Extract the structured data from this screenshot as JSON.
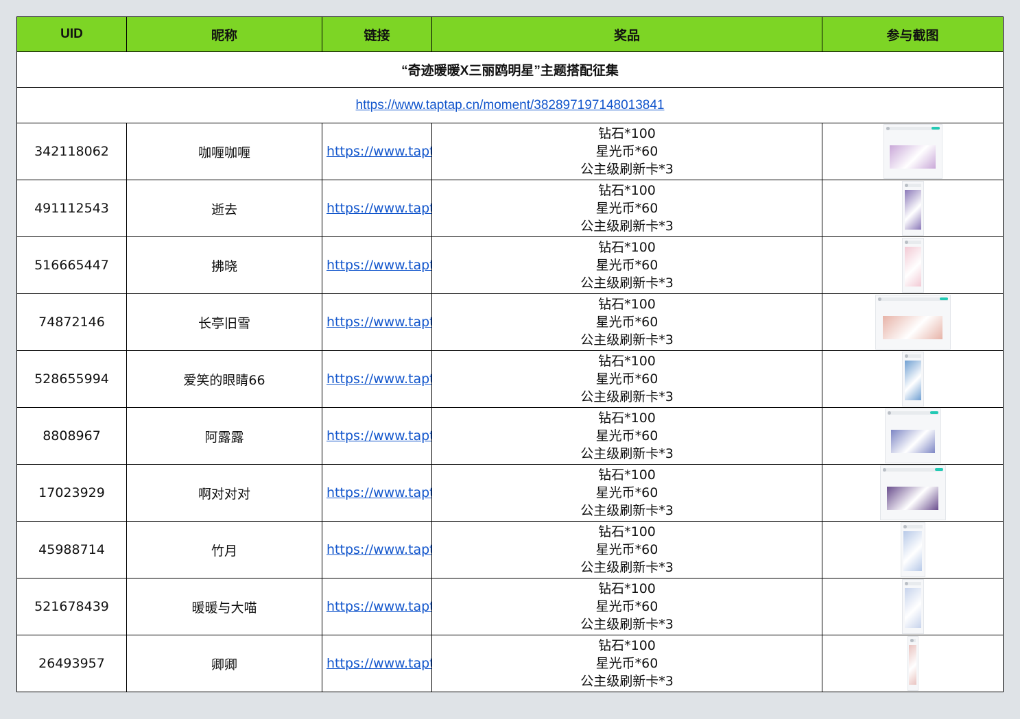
{
  "headers": {
    "uid": "UID",
    "nickname": "昵称",
    "link": "链接",
    "prize": "奖品",
    "screenshot": "参与截图"
  },
  "event_title": "“奇迹暖暖X三丽鸥明星”主题搭配征集",
  "event_url": "https://www.taptap.cn/moment/382897197148013841",
  "rows": [
    {
      "uid": "342118062",
      "nickname": "咖喱咖喱",
      "link": "https://www.taptap",
      "prize": [
        "钻石*100",
        "星光币*60",
        "公主级刷新卡*3"
      ]
    },
    {
      "uid": "491112543",
      "nickname": "逝去",
      "link": "https://www.taptap",
      "prize": [
        "钻石*100",
        "星光币*60",
        "公主级刷新卡*3"
      ]
    },
    {
      "uid": "516665447",
      "nickname": "拂晓",
      "link": "https://www.taptap",
      "prize": [
        "钻石*100",
        "星光币*60",
        "公主级刷新卡*3"
      ]
    },
    {
      "uid": "74872146",
      "nickname": "长亭旧雪",
      "link": "https://www.taptap",
      "prize": [
        "钻石*100",
        "星光币*60",
        "公主级刷新卡*3"
      ]
    },
    {
      "uid": "528655994",
      "nickname": "爱笑的眼睛66",
      "link": "https://www.taptap",
      "prize": [
        "钻石*100",
        "星光币*60",
        "公主级刷新卡*3"
      ]
    },
    {
      "uid": "8808967",
      "nickname": "阿露露",
      "link": "https://www.taptap",
      "prize": [
        "钻石*100",
        "星光币*60",
        "公主级刷新卡*3"
      ]
    },
    {
      "uid": "17023929",
      "nickname": "啊对对对",
      "link": "https://www.taptap",
      "prize": [
        "钻石*100",
        "星光币*60",
        "公主级刷新卡*3"
      ]
    },
    {
      "uid": "45988714",
      "nickname": "竹月",
      "link": "https://www.taptap",
      "prize": [
        "钻石*100",
        "星光币*60",
        "公主级刷新卡*3"
      ]
    },
    {
      "uid": "521678439",
      "nickname": "暖暖与大喵",
      "link": "https://www.taptap",
      "prize": [
        "钻石*100",
        "星光币*60",
        "公主级刷新卡*3"
      ]
    },
    {
      "uid": "26493957",
      "nickname": "卿卿",
      "link": "https://www.taptap",
      "prize": [
        "钻石*100",
        "星光币*60",
        "公主级刷新卡*3"
      ]
    }
  ],
  "thumb_colors": [
    "#c9a8d8",
    "#8a78b8",
    "#f2c9d4",
    "#e7b3a8",
    "#6f9fd2",
    "#7d86c4",
    "#6a4e8e",
    "#b7c9e8",
    "#c7d3ec",
    "#e9c3c0"
  ]
}
